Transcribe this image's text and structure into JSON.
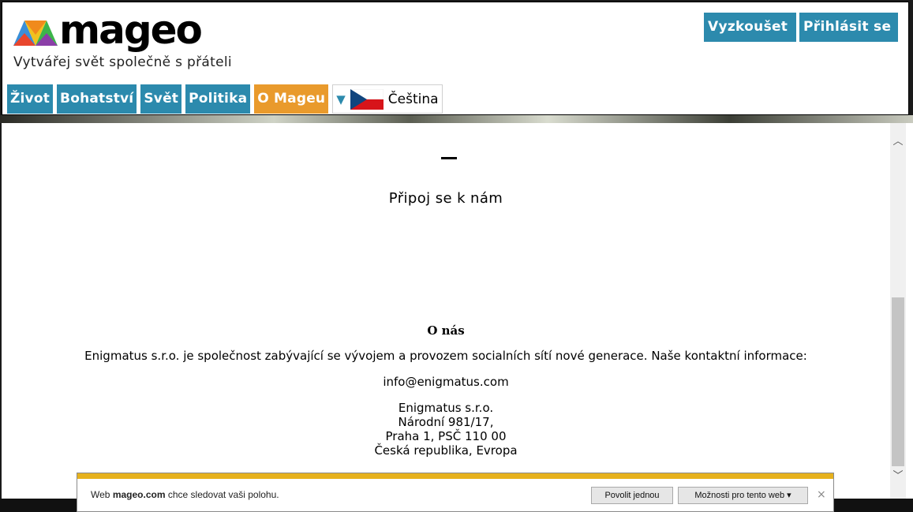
{
  "header": {
    "logo_text": "mageo",
    "tagline": "Vytvářej svět společně s přáteli",
    "try_label": "Vyzkoušet",
    "login_label": "Přihlásit se",
    "nav": [
      {
        "label": "Život"
      },
      {
        "label": "Bohatství"
      },
      {
        "label": "Svět"
      },
      {
        "label": "Politika"
      },
      {
        "label": "O Mageu",
        "active": true
      }
    ],
    "language": {
      "label": "Čeština",
      "flag": "czech-flag"
    }
  },
  "content": {
    "join_text": "Připoj se k nám",
    "about_title": "O nás",
    "about_text": "Enigmatus s.r.o. je společnost zabývající se vývojem a provozem socialních sítí nové generace. Naše kontaktní informace:",
    "email": "info@enigmatus.com",
    "address": [
      "Enigmatus s.r.o.",
      "Národní 981/17,",
      "Praha 1, PSČ 110 00",
      "Česká republika, Evropa"
    ]
  },
  "notification": {
    "text_prefix": "Web",
    "domain": "mageo.com",
    "text_suffix": "chce sledovat vaši polohu.",
    "allow_label": "Povolit jednou",
    "options_label": "Možnosti pro tento web",
    "options_caret": "▾",
    "close_glyph": "×"
  },
  "colors": {
    "accent_blue": "#2c8aad",
    "accent_orange": "#e99a2c",
    "notif_yellow": "#e6b11d"
  }
}
